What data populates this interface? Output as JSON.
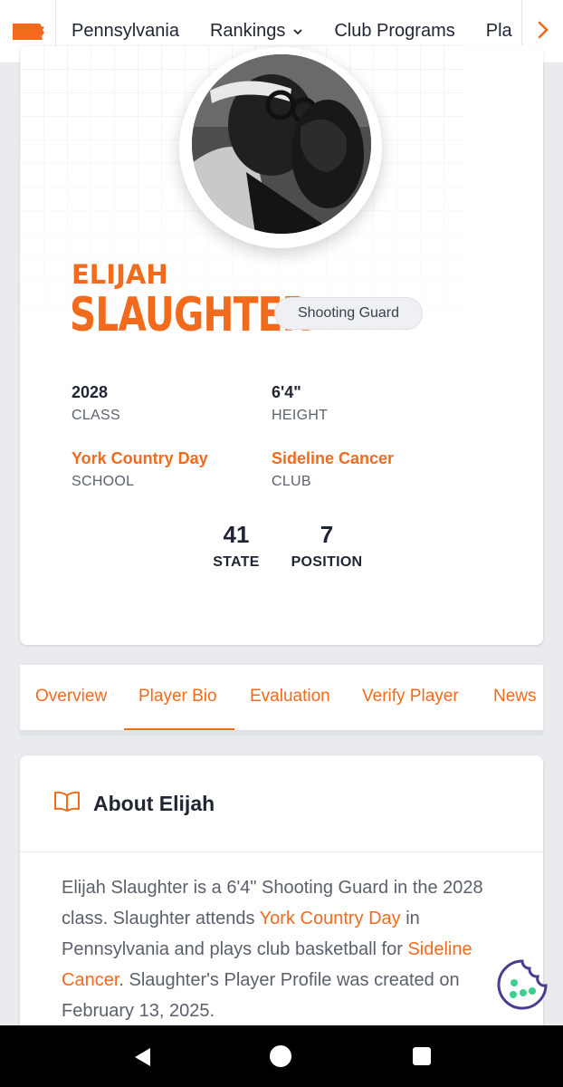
{
  "nav": {
    "logo_icon": "pennsylvania-state-icon",
    "items": [
      {
        "label": "Pennsylvania"
      },
      {
        "label": "Rankings",
        "chevron": "⌄"
      },
      {
        "label": "Club Programs"
      },
      {
        "label": "Pla"
      }
    ],
    "next_icon": "chevron-right-icon"
  },
  "profile": {
    "first_name": "ELIJAH",
    "last_name": "SLAUGHTER",
    "position_badge": "Shooting Guard",
    "stats": {
      "class_value": "2028",
      "class_label": "CLASS",
      "height_value": "6'4\"",
      "height_label": "HEIGHT",
      "school_value": "York Country Day",
      "school_label": "SCHOOL",
      "club_value": "Sideline Cancer",
      "club_label": "CLUB"
    },
    "ranks": {
      "state_value": "41",
      "state_label": "STATE",
      "position_value": "7",
      "position_label": "POSITION"
    }
  },
  "tabs": {
    "items": [
      "Overview",
      "Player Bio",
      "Evaluation",
      "Verify Player",
      "News"
    ],
    "active": "Player Bio"
  },
  "about": {
    "title": "About Elijah",
    "icon": "book-icon",
    "text_1": "Elijah Slaughter is a 6'4\" Shooting Guard in the 2028 class. Slaughter attends ",
    "link_school": "York Country Day",
    "text_2": " in Pennsylvania and plays club basketball for ",
    "link_club": "Sideline Cancer",
    "text_3": ". Slaughter's Player Profile was created on February 13, 2025."
  },
  "colors": {
    "accent": "#f26a1b",
    "cookie_outline": "#4a3d8f",
    "cookie_dots": "#3ecf8e"
  }
}
